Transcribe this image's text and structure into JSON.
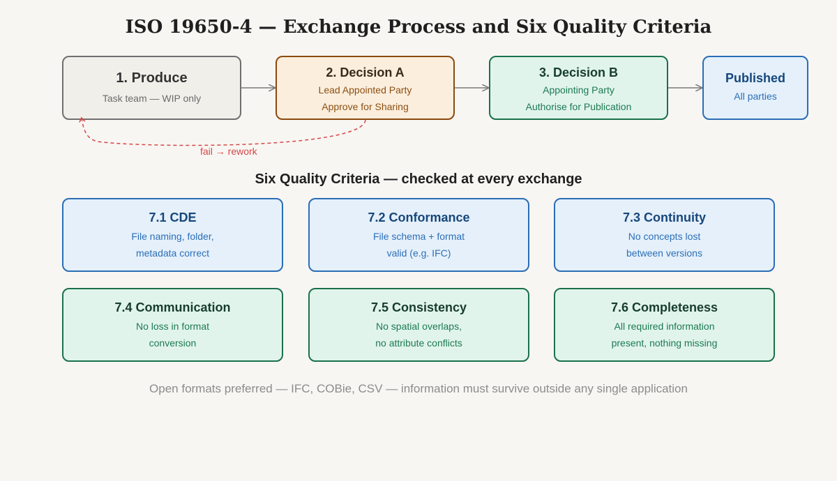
{
  "title": "ISO 19650-4 — Exchange Process and Six Quality Criteria",
  "steps": [
    {
      "heading": "1. Produce",
      "lines": [
        "Task team — WIP only"
      ]
    },
    {
      "heading": "2. Decision A",
      "lines": [
        "Lead Appointed Party",
        "Approve for Sharing"
      ]
    },
    {
      "heading": "3. Decision B",
      "lines": [
        "Appointing Party",
        "Authorise for Publication"
      ]
    },
    {
      "heading": "Published",
      "lines": [
        "All parties"
      ]
    }
  ],
  "loop_label": "fail → rework",
  "criteria_title": "Six Quality Criteria — checked at every exchange",
  "criteria": [
    {
      "heading": "7.1 CDE",
      "lines": [
        "File naming, folder,",
        "metadata correct"
      ]
    },
    {
      "heading": "7.2 Conformance",
      "lines": [
        "File schema + format",
        "valid (e.g. IFC)"
      ]
    },
    {
      "heading": "7.3 Continuity",
      "lines": [
        "No concepts lost",
        "between versions"
      ]
    },
    {
      "heading": "7.4 Communication",
      "lines": [
        "No loss in format",
        "conversion"
      ]
    },
    {
      "heading": "7.5 Consistency",
      "lines": [
        "No spatial overlaps,",
        "no attribute conflicts"
      ]
    },
    {
      "heading": "7.6 Completeness",
      "lines": [
        "All required information",
        "present, nothing missing"
      ]
    }
  ],
  "footer": "Open formats preferred — IFC, COBie, CSV — information must survive outside any single application",
  "colors": {
    "background": "#f8f6f3",
    "produce": "#6f6f6f",
    "decision_a": "#8b4a0e",
    "decision_b": "#19714b",
    "published": "#2a6db5",
    "rework": "#d34848",
    "arrow": "#7a7a7a"
  }
}
